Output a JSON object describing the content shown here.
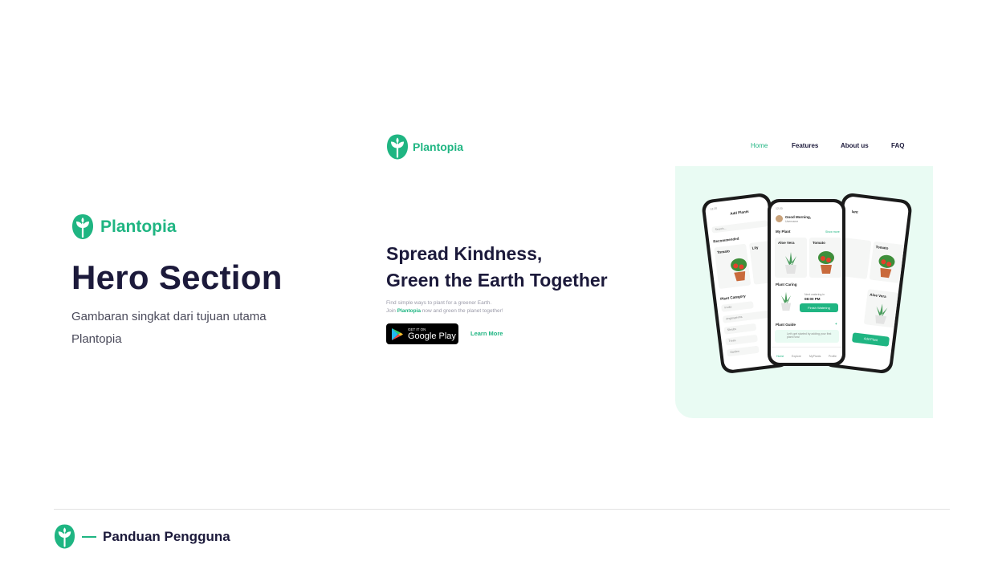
{
  "brand": {
    "name": "Plantopia"
  },
  "section": {
    "title": "Hero Section",
    "description": "Gambaran singkat dari tujuan utama Plantopia"
  },
  "mockup": {
    "brand_name": "Plantopia",
    "nav": [
      {
        "label": "Home",
        "active": true
      },
      {
        "label": "Features",
        "active": false
      },
      {
        "label": "About us",
        "active": false
      },
      {
        "label": "FAQ",
        "active": false
      }
    ],
    "headline_line1": "Spread Kindness,",
    "headline_line2": "Green the Earth Together",
    "sub_line1": "Find simple ways to plant for a greener Earth.",
    "sub_join": "Join ",
    "sub_brand": "Plantopia",
    "sub_rest": " now and green the planet together!",
    "google_play_small": "GET IT ON",
    "google_play_big": "Google Play",
    "learn_more": "Learn More",
    "phone_left": {
      "time": "12:20",
      "title": "Add Plants",
      "search": "Search...",
      "recommended": "Recommended",
      "card1": "Tomato",
      "card2": "Lily",
      "category_title": "Plant Category",
      "categories": [
        "Fruits",
        "Angiosperms",
        "Shrubs",
        "Trees",
        "Garden"
      ]
    },
    "phone_center": {
      "time": "12:20",
      "greeting": "Good Morning,",
      "username": "Username",
      "my_plant": "My Plant",
      "show_more": "Show more",
      "plant1": "Aloe Vera",
      "plant2": "Tomato",
      "plant_caring": "Plant Caring",
      "next_watering": "Next watering in",
      "watering_time": "08:00 PM",
      "finish_button": "Finish Watering",
      "plant_guide": "Plant Guide",
      "guide_text": "Let's get started by adding your first plant now!",
      "tabs": [
        "Home",
        "Explore",
        "MyPlants",
        "Profile"
      ]
    },
    "phone_right": {
      "title": "lant",
      "card1": "Tomato",
      "card2": "Aloe Vera",
      "add_button": "Add Plant"
    }
  },
  "footer": {
    "label": "Panduan Pengguna"
  },
  "colors": {
    "accent": "#1fb582",
    "dark": "#1c1a3b",
    "mint": "#e9fbf3"
  }
}
